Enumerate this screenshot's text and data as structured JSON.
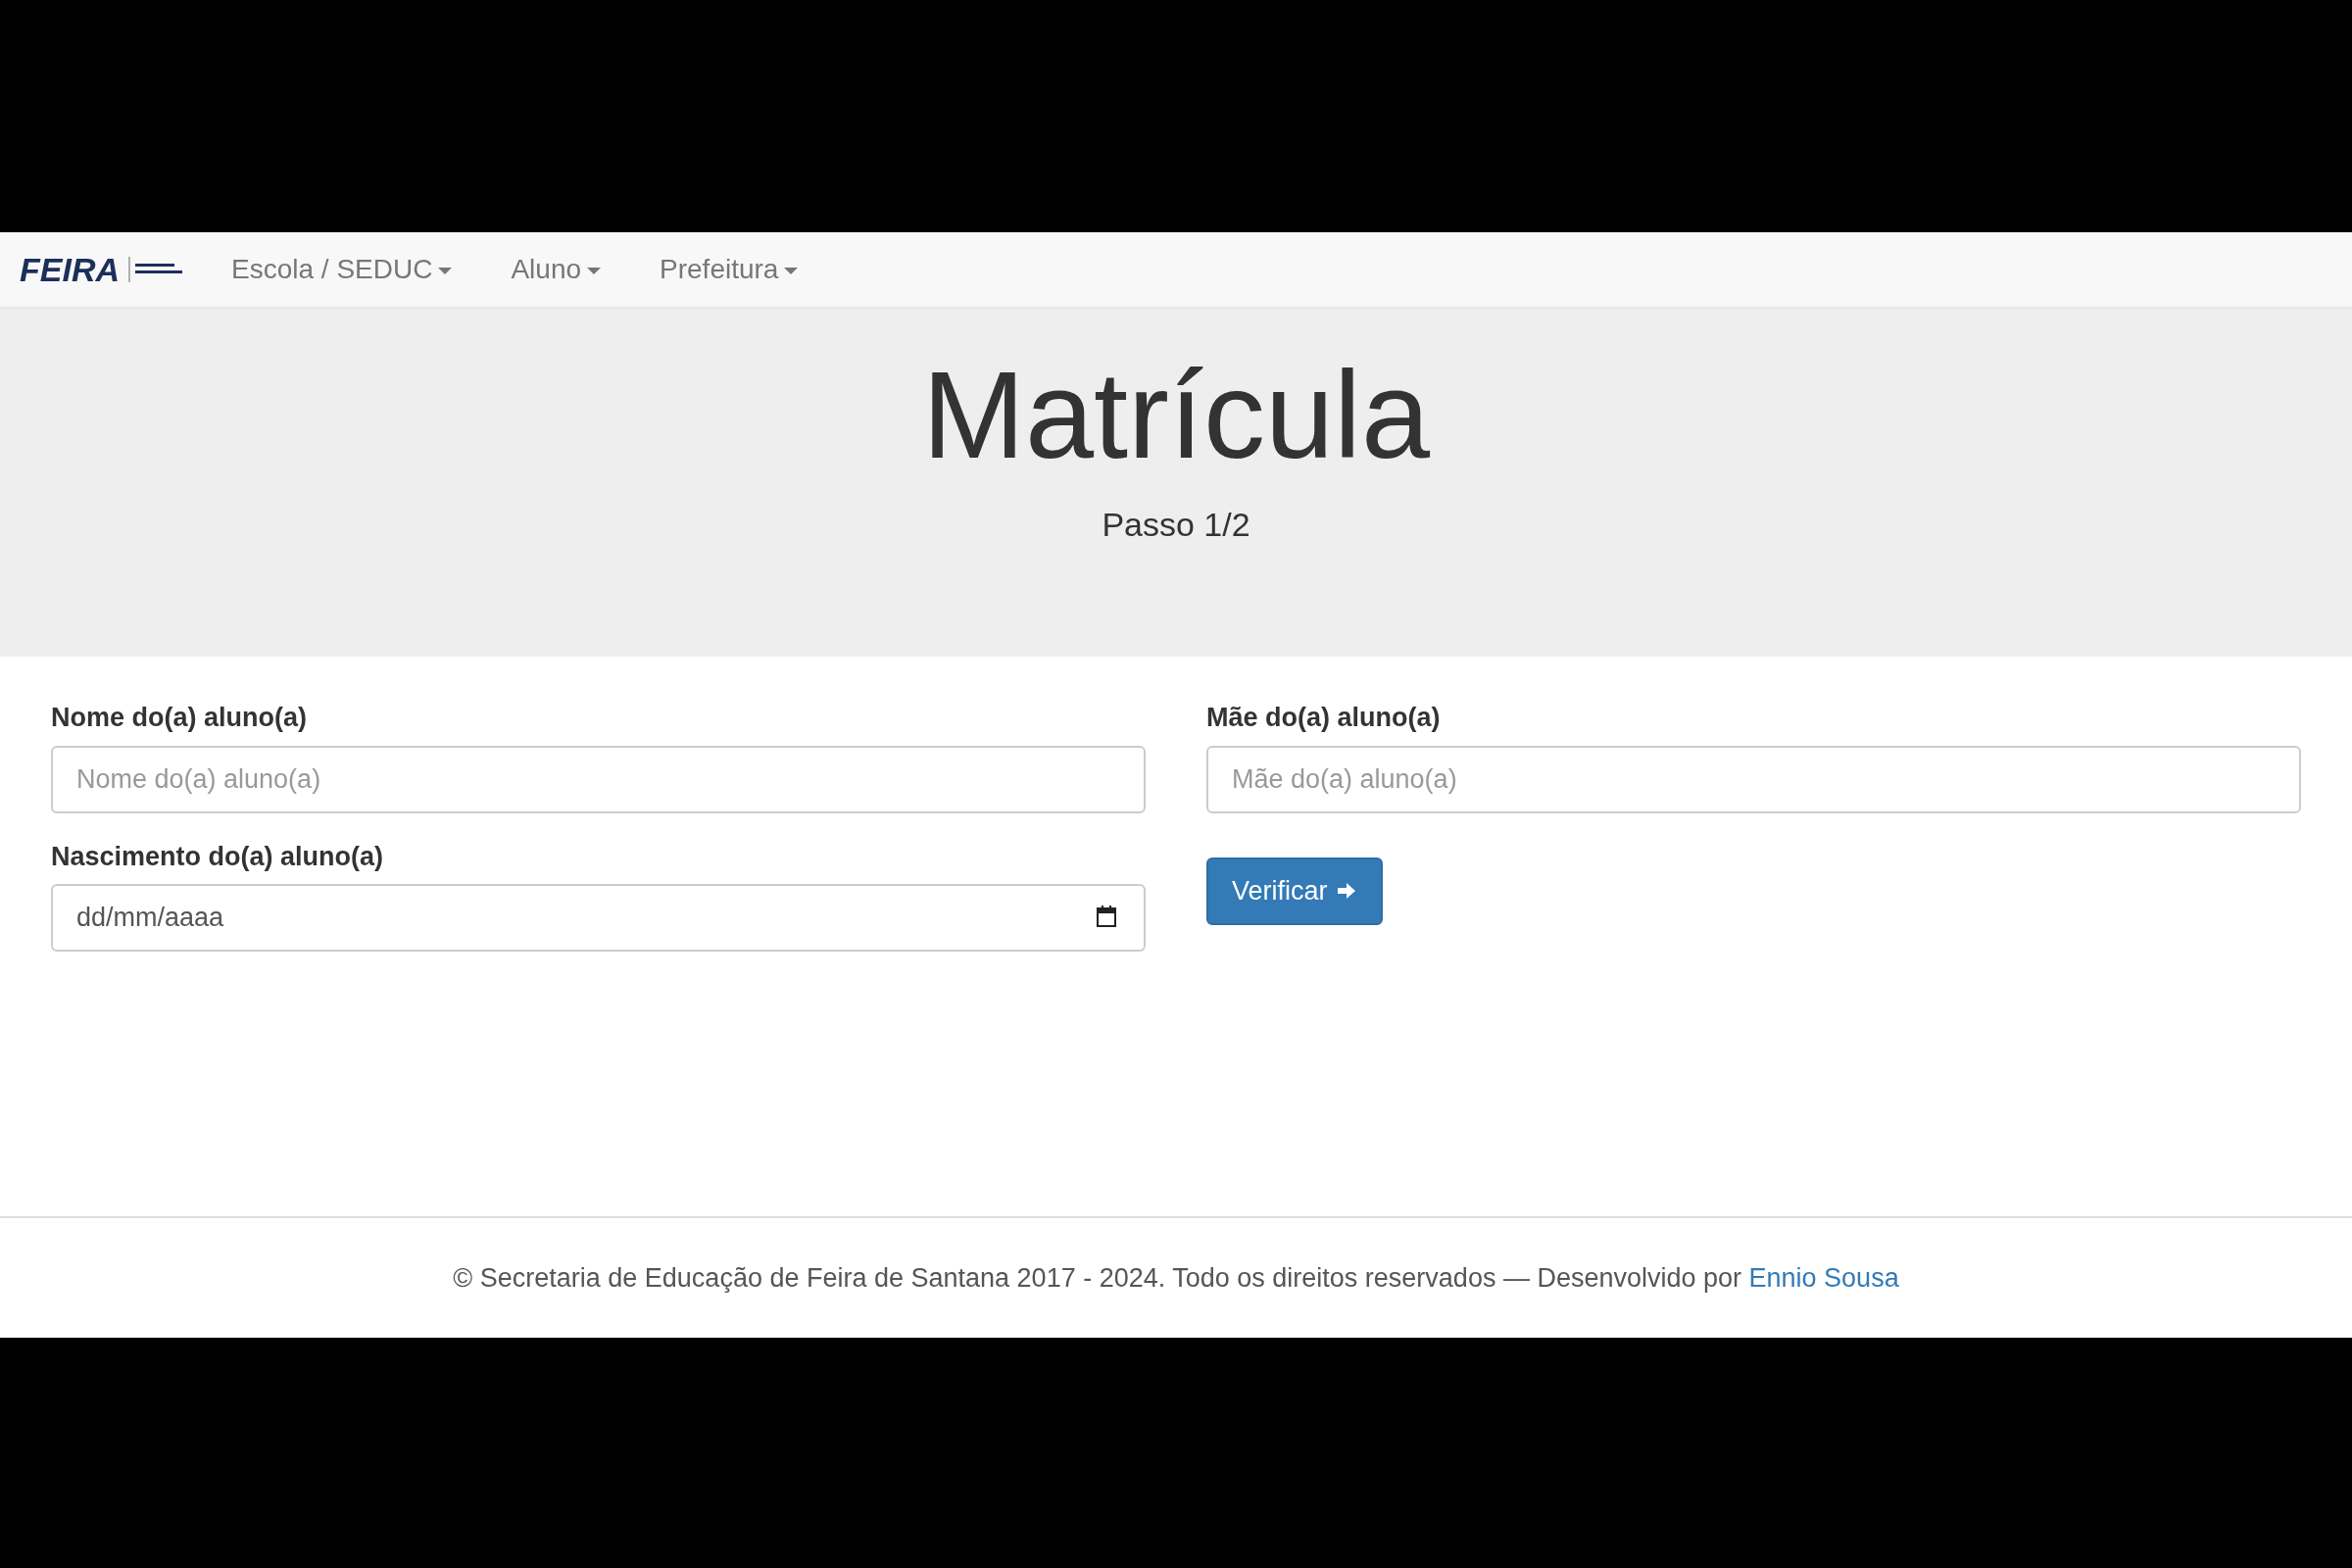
{
  "navbar": {
    "logo": {
      "text": "FEIRA"
    },
    "menus": [
      {
        "label": "Escola / SEDUC"
      },
      {
        "label": "Aluno"
      },
      {
        "label": "Prefeitura"
      }
    ]
  },
  "header": {
    "title": "Matrícula",
    "subtitle": "Passo 1/2"
  },
  "form": {
    "fields": [
      {
        "kind": "text",
        "label": "Nome do(a) aluno(a)",
        "placeholder": "Nome do(a) aluno(a)"
      },
      {
        "kind": "text",
        "label": "Mãe do(a) aluno(a)",
        "placeholder": "Mãe do(a) aluno(a)"
      },
      {
        "kind": "date",
        "label": "Nascimento do(a) aluno(a)",
        "placeholder": "dd/mm/aaaa"
      }
    ],
    "button": {
      "label": "Verificar"
    }
  },
  "footer": {
    "text": "© Secretaria de Educação de Feira de Santana 2017 - 2024. Todo os direitos reservados — Desenvolvido por",
    "link": "Ennio Sousa"
  }
}
